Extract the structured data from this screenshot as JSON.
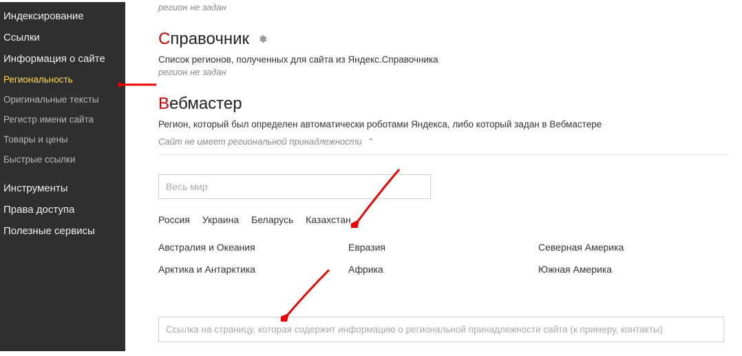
{
  "sidebar": {
    "items": [
      {
        "label": "Индексирование",
        "type": "main"
      },
      {
        "label": "Ссылки",
        "type": "main"
      },
      {
        "label": "Информация о сайте",
        "type": "main"
      },
      {
        "label": "Региональность",
        "type": "sub",
        "active": true
      },
      {
        "label": "Оригинальные тексты",
        "type": "sub"
      },
      {
        "label": "Регистр имени сайта",
        "type": "sub"
      },
      {
        "label": "Товары и цены",
        "type": "sub"
      },
      {
        "label": "Быстрые ссылки",
        "type": "sub"
      },
      {
        "label": "Инструменты",
        "type": "main"
      },
      {
        "label": "Права доступа",
        "type": "main"
      },
      {
        "label": "Полезные сервисы",
        "type": "main"
      }
    ]
  },
  "topStatus": "регион не задан",
  "sections": {
    "spravochnik": {
      "firstLetter": "С",
      "rest": "правочник",
      "desc": "Список регионов, полученных для сайта из Яндекс.Справочника",
      "status": "регион не задан"
    },
    "webmaster": {
      "firstLetter": "В",
      "rest": "ебмастер",
      "desc": "Регион, который был определен автоматически роботами Яндекса, либо который задан в Вебмастере",
      "collapse": "Сайт не имеет региональной принадлежности"
    }
  },
  "searchPlaceholder": "Весь мир",
  "countries": [
    "Россия",
    "Украина",
    "Беларусь",
    "Казахстан"
  ],
  "regions": {
    "col1": [
      "Австралия и Океания",
      "Арктика и Антарктика"
    ],
    "col2": [
      "Евразия",
      "Африка"
    ],
    "col3": [
      "Северная Америка",
      "Южная Америка"
    ]
  },
  "urlPlaceholder": "Ссылка на страницу, которая содержит информацию о региональной принадлежности сайта (к примеру, контакты)"
}
